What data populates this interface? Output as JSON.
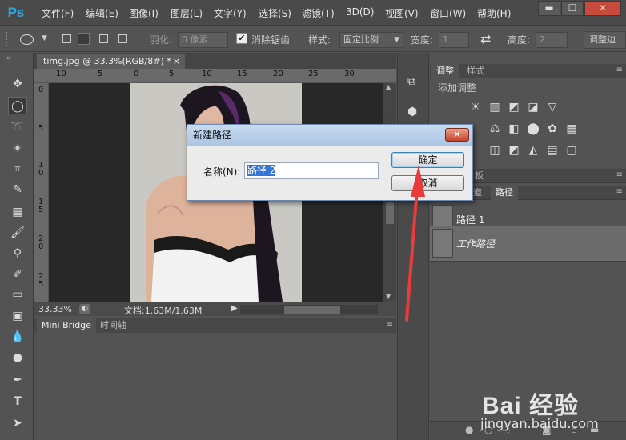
{
  "app": {
    "logo": "Ps"
  },
  "menu": [
    "文件(F)",
    "编辑(E)",
    "图像(I)",
    "图层(L)",
    "文字(Y)",
    "选择(S)",
    "滤镜(T)",
    "3D(D)",
    "视图(V)",
    "窗口(W)",
    "帮助(H)"
  ],
  "window_controls": [
    "▬",
    "☐",
    "✕"
  ],
  "options": {
    "feather_label": "羽化:",
    "feather_value": "0 像素",
    "antialias_label": "消除锯齿",
    "antialias_checked": true,
    "style_label": "样式:",
    "style_value": "固定比例",
    "width_label": "宽度:",
    "width_value": "1",
    "height_label": "高度:",
    "height_value": "2",
    "refine_edge": "调整边"
  },
  "document": {
    "tab_title": "timg.jpg @ 33.3%(RGB/8#) *",
    "close": "×",
    "zoom": "33.33%",
    "doc_info": "文档:1.63M/1.63M"
  },
  "rulers": {
    "horizontal": [
      "10",
      "5",
      "0",
      "5",
      "10",
      "15",
      "20",
      "25",
      "30"
    ],
    "vertical": [
      "0",
      "5",
      "1\n0",
      "1\n5",
      "2\n0",
      "2\n5"
    ]
  },
  "bottom_panel": {
    "tabs": [
      "Mini Bridge",
      "时间轴"
    ]
  },
  "panels": {
    "top_tabs": [
      "调整",
      "样式"
    ],
    "add_adjustment": "添加调整",
    "mid_tab_partial": "板",
    "lower_tabs": [
      "道",
      "路径"
    ],
    "paths": [
      {
        "name": "路径 1",
        "italic": false
      },
      {
        "name": "工作路径",
        "italic": true
      }
    ]
  },
  "dialog": {
    "title": "新建路径",
    "close": "✕",
    "name_label": "名称(N):",
    "name_value": "路径 2",
    "ok": "确定",
    "cancel": "取消"
  },
  "watermark": {
    "brand": "Bai 经验",
    "url": "jingyan.baidu.com"
  },
  "colors": {
    "accent": "#2fa8e0",
    "arrow": "#e83c3c",
    "selection": "#3375d6"
  }
}
